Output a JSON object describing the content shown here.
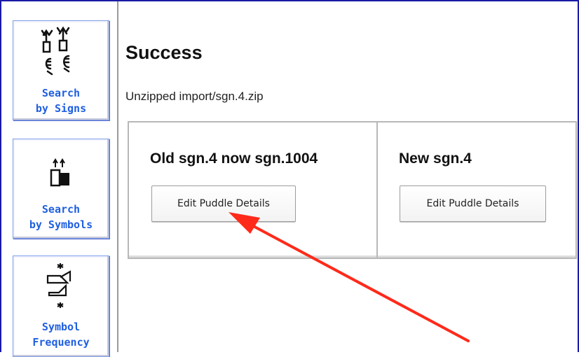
{
  "sidebar": {
    "items": [
      {
        "label": "Search\nby Signs",
        "icon": "hand-signs-icon"
      },
      {
        "label": "Search\nby Symbols",
        "icon": "symbol-blocks-icon"
      },
      {
        "label": "Symbol\nFrequency",
        "icon": "symbol-frequency-icon"
      }
    ]
  },
  "main": {
    "title": "Success",
    "message": "Unzipped import/sgn.4.zip",
    "panels": [
      {
        "heading": "Old sgn.4 now sgn.1004",
        "button_label": "Edit Puddle Details"
      },
      {
        "heading": "New sgn.4",
        "button_label": "Edit Puddle Details"
      }
    ]
  },
  "colors": {
    "frame": "#1a1aa8",
    "nav_label": "#1f5fe0",
    "annotation_arrow": "#ff2a1a"
  }
}
